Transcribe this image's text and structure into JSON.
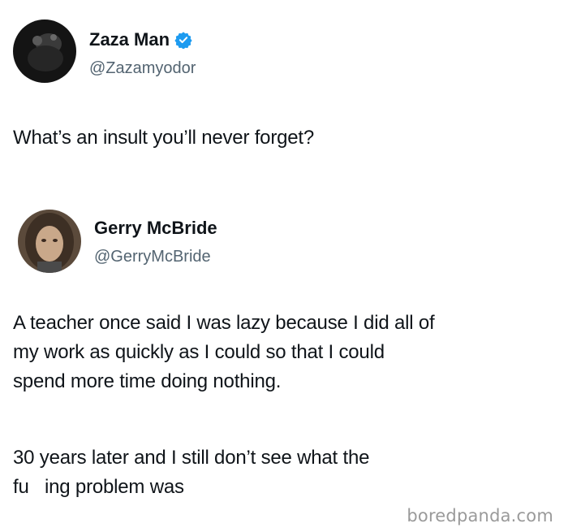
{
  "post": {
    "author": {
      "display_name": "Zaza Man",
      "handle": "@Zazamyodor",
      "verified": true,
      "verified_color": "#1d9bf0",
      "avatar_icon": "dark-photo-avatar"
    },
    "text": "What’s an insult you’ll never forget?"
  },
  "reply": {
    "author": {
      "display_name": "Gerry McBride",
      "handle": "@GerryMcBride",
      "avatar_icon": "man-long-hair-photo-avatar"
    },
    "paragraph_1": [
      "A teacher once said I was lazy because I did all of",
      "my work as quickly as I could so that I could",
      "spend more time doing nothing."
    ],
    "paragraph_2": [
      "30 years later and I still don’t see what the",
      "fu   ing problem was"
    ]
  },
  "watermark": "boredpanda.com"
}
